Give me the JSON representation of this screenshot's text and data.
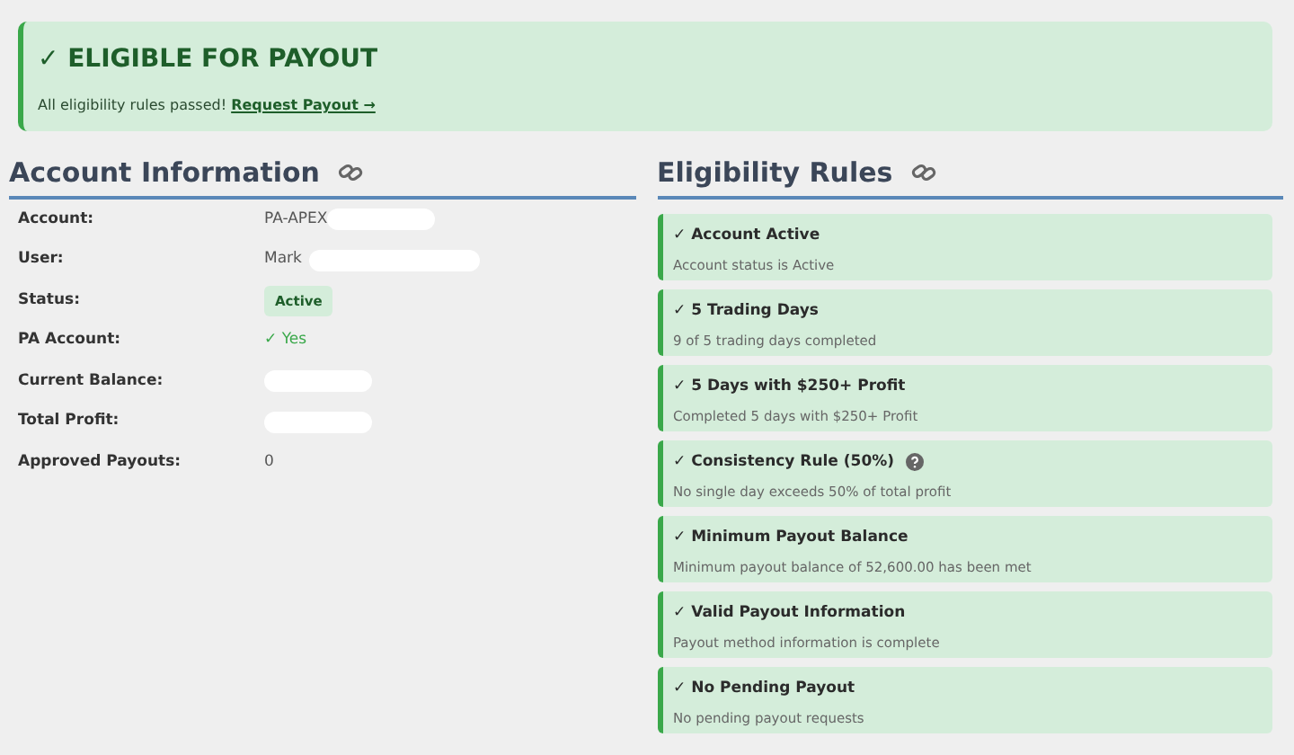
{
  "banner": {
    "title": "✓ ELIGIBLE FOR PAYOUT",
    "message": "All eligibility rules passed!",
    "link": "Request Payout →"
  },
  "account": {
    "heading": "Account Information",
    "rows": [
      {
        "label": "Account:",
        "value": "PA-APEX",
        "kind": "text",
        "redacted": true
      },
      {
        "label": "User:",
        "value": "Mark",
        "kind": "text",
        "redacted": true
      },
      {
        "label": "Status:",
        "value": "Active",
        "kind": "badge"
      },
      {
        "label": "PA Account:",
        "value": "✓ Yes",
        "kind": "success"
      },
      {
        "label": "Current Balance:",
        "redacted": true
      },
      {
        "label": "Total Profit:",
        "redacted": true
      },
      {
        "label": "Approved Payouts:",
        "value": "0",
        "kind": "text"
      }
    ]
  },
  "rules": {
    "heading": "Eligibility Rules",
    "items": [
      {
        "title": "✓ Account Active",
        "detail": "Account status is Active",
        "help": false
      },
      {
        "title": "✓ 5 Trading Days",
        "detail": "9 of 5 trading days completed",
        "help": false
      },
      {
        "title": "✓ 5 Days with $250+ Profit",
        "detail": "Completed 5 days with $250+ Profit",
        "help": false
      },
      {
        "title": "✓ Consistency Rule (50%)",
        "detail": "No single day exceeds 50% of total profit",
        "help": true
      },
      {
        "title": "✓ Minimum Payout Balance",
        "detail": "Minimum payout balance of 52,600.00 has been met",
        "help": false
      },
      {
        "title": "✓ Valid Payout Information",
        "detail": "Payout method information is complete",
        "help": false
      },
      {
        "title": "✓ No Pending Payout",
        "detail": "No pending payout requests",
        "help": false
      }
    ]
  }
}
